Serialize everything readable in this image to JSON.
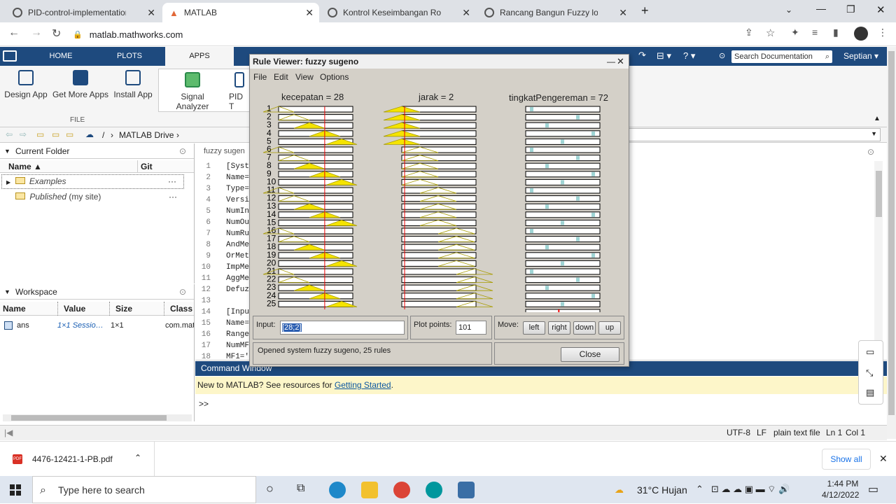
{
  "browser": {
    "tabs": [
      {
        "label": "PID-control-implementation-Ard"
      },
      {
        "label": "MATLAB"
      },
      {
        "label": "Kontrol Keseimbangan Robot He"
      },
      {
        "label": "Rancang Bangun Fuzzy logic Con"
      }
    ],
    "url": "matlab.mathworks.com",
    "new_tab": "+"
  },
  "matlab": {
    "tabs": [
      "HOME",
      "PLOTS",
      "APPS"
    ],
    "search_placeholder": "Search Documentation",
    "user": "Septian",
    "toolstrip": {
      "design_app": "Design App",
      "get_more_apps": "Get More Apps",
      "install_app": "Install App",
      "signal_analyzer": "Signal Analyzer",
      "pid": "PID T",
      "file_group": "FILE"
    },
    "path": [
      "/",
      "MATLAB Drive"
    ],
    "current_folder": {
      "title": "Current Folder",
      "col_name": "Name",
      "col_git": "Git",
      "items": [
        {
          "name": "Examples",
          "suffix": ""
        },
        {
          "name": "Published",
          "suffix": "(my site)"
        }
      ]
    },
    "workspace": {
      "title": "Workspace",
      "cols": [
        "Name",
        "Value",
        "Size",
        "Class"
      ],
      "rows": [
        {
          "name": "ans",
          "value": "1×1 Sessio…",
          "size": "1×1",
          "class": "com.mat"
        }
      ]
    },
    "editor": {
      "tab": "fuzzy sugen",
      "lines": [
        {
          "n": "1",
          "t": "[Syst"
        },
        {
          "n": "2",
          "t": "Name="
        },
        {
          "n": "3",
          "t": "Type="
        },
        {
          "n": "4",
          "t": "Versi"
        },
        {
          "n": "5",
          "t": "NumIn"
        },
        {
          "n": "6",
          "t": "NumOu"
        },
        {
          "n": "7",
          "t": "NumRu"
        },
        {
          "n": "8",
          "t": "AndMe"
        },
        {
          "n": "9",
          "t": "OrMet"
        },
        {
          "n": "10",
          "t": "ImpMe"
        },
        {
          "n": "11",
          "t": "AggMe"
        },
        {
          "n": "12",
          "t": "Defuz"
        },
        {
          "n": "13",
          "t": ""
        },
        {
          "n": "14",
          "t": "[Inpu"
        },
        {
          "n": "15",
          "t": "Name="
        },
        {
          "n": "16",
          "t": "Range"
        },
        {
          "n": "17",
          "t": "NumMF"
        },
        {
          "n": "18",
          "t": "MF1='"
        }
      ]
    },
    "command_window": {
      "title": "Command Window",
      "new_msg": "New to MATLAB? See resources for ",
      "link": "Getting Started",
      "period": ".",
      "prompt": ">>"
    },
    "status": {
      "encoding": "UTF-8",
      "eol": "LF",
      "type": "plain text file",
      "ln": "Ln 1",
      "col": "Col 1"
    }
  },
  "rule_viewer": {
    "title": "Rule Viewer: fuzzy sugeno",
    "menu": [
      "File",
      "Edit",
      "View",
      "Options"
    ],
    "headers": {
      "in1": "kecepatan = 28",
      "in2": "jarak = 2",
      "out": "tingkatPengereman = 72"
    },
    "rules": [
      "1",
      "2",
      "3",
      "4",
      "5",
      "6",
      "7",
      "8",
      "9",
      "10",
      "11",
      "12",
      "13",
      "14",
      "15",
      "16",
      "17",
      "18",
      "19",
      "20",
      "21",
      "22",
      "23",
      "24",
      "25"
    ],
    "input_label": "Input:",
    "input_value": "[28;2]",
    "plot_points_label": "Plot points:",
    "plot_points": "101",
    "move_label": "Move:",
    "buttons": {
      "left": "left",
      "right": "right",
      "down": "down",
      "up": "up",
      "close": "Close"
    },
    "status": "Opened system fuzzy sugeno, 25 rules",
    "kecepatan_value": 28,
    "jarak_value": 2,
    "output_value": 72
  },
  "downloads": {
    "file": "4476-12421-1-PB.pdf",
    "show_all": "Show all"
  },
  "taskbar": {
    "search": "Type here to search",
    "weather": "31°C  Hujan",
    "time": "1:44 PM",
    "date": "4/12/2022"
  }
}
